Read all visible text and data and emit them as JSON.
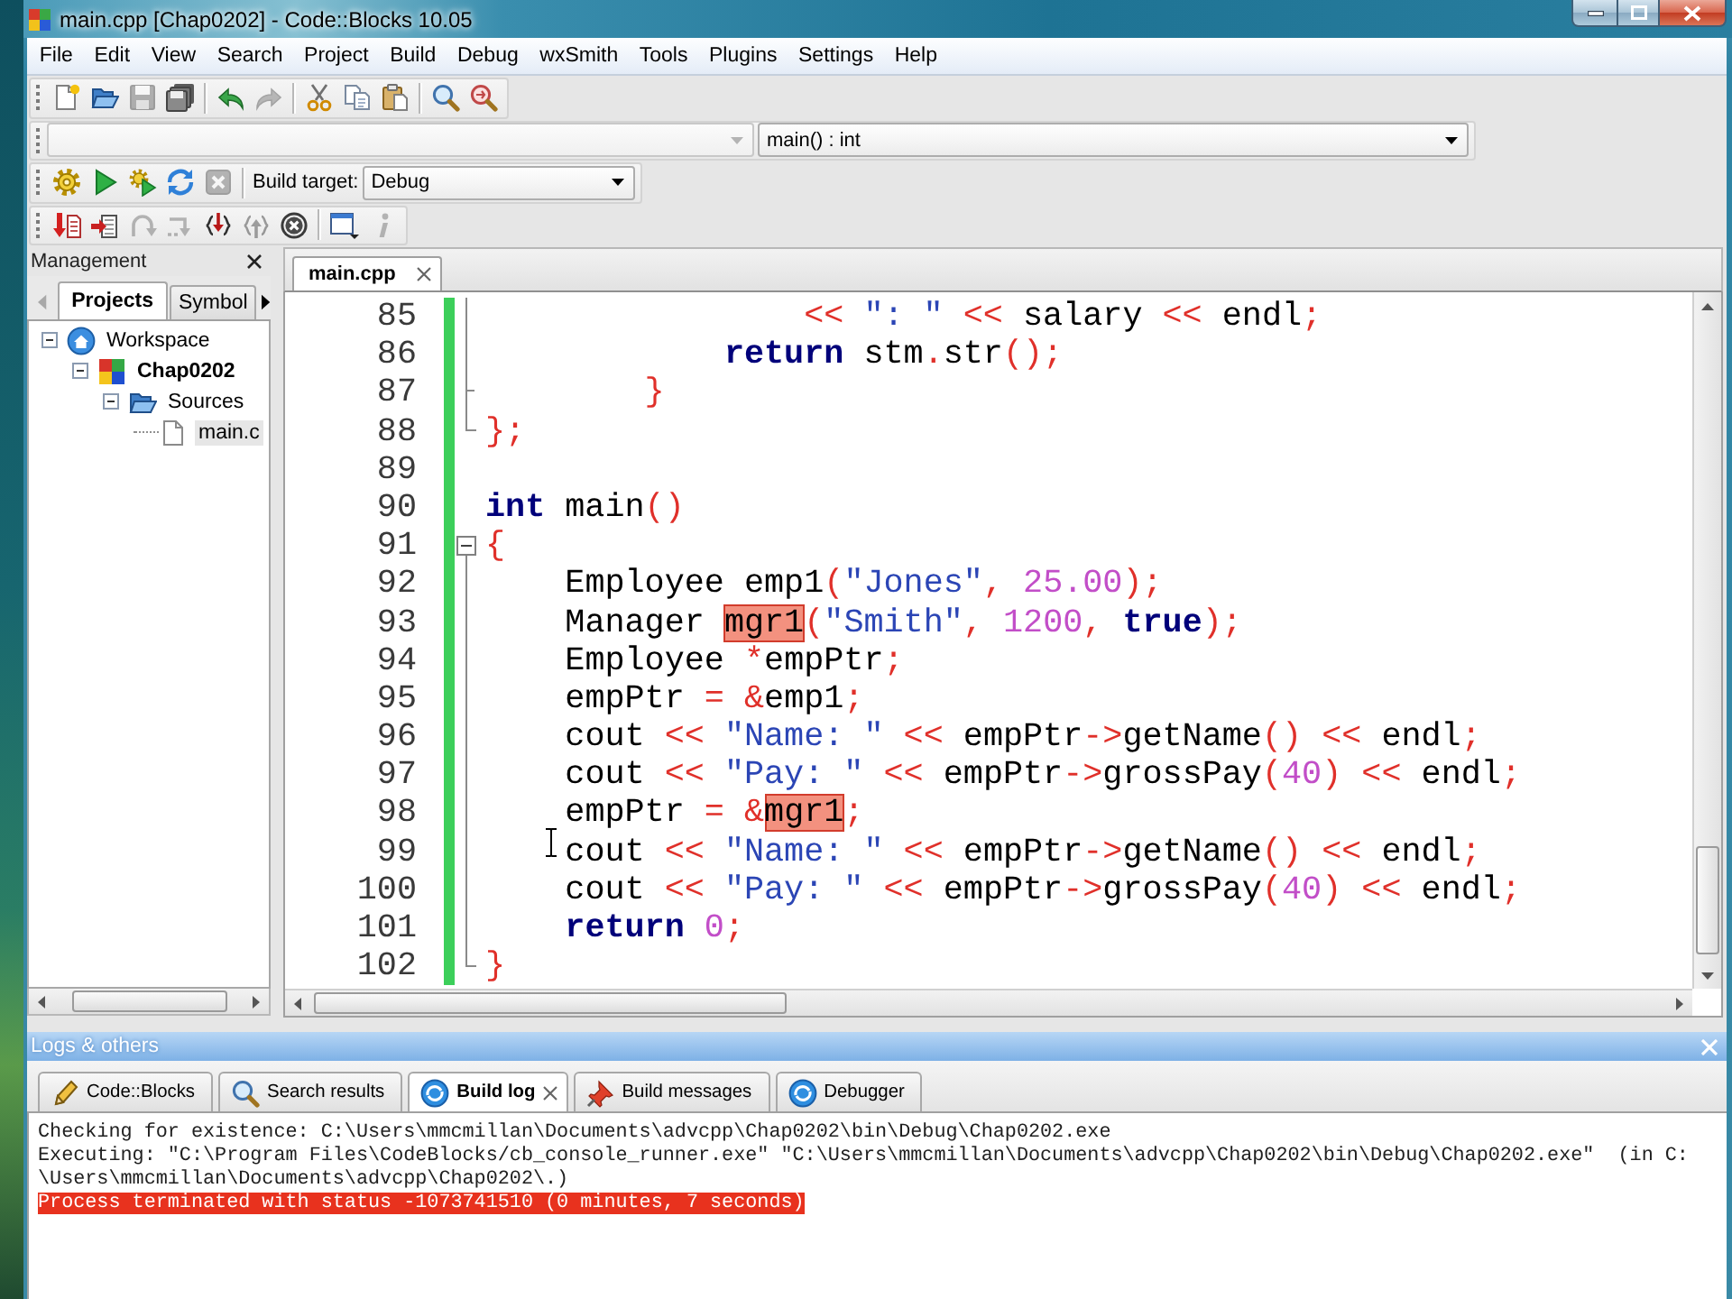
{
  "window": {
    "title": "main.cpp [Chap0202] - Code::Blocks 10.05"
  },
  "menu": [
    "File",
    "Edit",
    "View",
    "Search",
    "Project",
    "Build",
    "Debug",
    "wxSmith",
    "Tools",
    "Plugins",
    "Settings",
    "Help"
  ],
  "main_toolbar": {
    "groups": [
      [
        {
          "kind": "new",
          "disabled": false
        },
        {
          "kind": "open",
          "disabled": false
        },
        {
          "kind": "save",
          "disabled": true
        },
        {
          "kind": "saveall",
          "disabled": false
        }
      ],
      [
        {
          "kind": "undo",
          "disabled": false
        },
        {
          "kind": "redo",
          "disabled": true
        }
      ],
      [
        {
          "kind": "cut",
          "disabled": false
        },
        {
          "kind": "copy",
          "disabled": false
        },
        {
          "kind": "paste",
          "disabled": false
        }
      ],
      [
        {
          "kind": "find",
          "disabled": false
        },
        {
          "kind": "replace",
          "disabled": false
        }
      ]
    ]
  },
  "code_completion_toolbar": {
    "scope_box": {
      "disabled": true
    },
    "function_box": {
      "value": "main() : int",
      "disabled": false
    }
  },
  "compiler_toolbar": {
    "groups": [
      [
        {
          "kind": "build",
          "disabled": false
        },
        {
          "kind": "run",
          "disabled": false
        },
        {
          "kind": "buildrun",
          "disabled": false
        },
        {
          "kind": "rebuild",
          "disabled": false
        },
        {
          "kind": "abort",
          "disabled": true
        }
      ]
    ],
    "build_target_label": "Build target:",
    "build_target": "Debug"
  },
  "debugger_toolbar": {
    "groups": [
      [
        {
          "kind": "debug",
          "disabled": false
        },
        {
          "kind": "runtocursor",
          "disabled": false
        },
        {
          "kind": "nextline",
          "disabled": true
        },
        {
          "kind": "nextinstruction",
          "disabled": true
        },
        {
          "kind": "stepinto",
          "disabled": false
        },
        {
          "kind": "stepout",
          "disabled": true
        },
        {
          "kind": "stop",
          "disabled": false
        }
      ],
      [
        {
          "kind": "windows",
          "disabled": false
        },
        {
          "kind": "info",
          "disabled": true
        }
      ]
    ]
  },
  "management": {
    "title": "Management",
    "tabs": [
      {
        "label": "Projects",
        "selected": true
      },
      {
        "label": "Symbol",
        "selected": false
      }
    ],
    "tree": [
      {
        "label": "Workspace",
        "kind": "workspace",
        "expanded": true,
        "active": false,
        "selected": false,
        "children": [
          {
            "label": "Chap0202",
            "kind": "project",
            "expanded": true,
            "active": true,
            "selected": false,
            "children": [
              {
                "label": "Sources",
                "kind": "folder",
                "expanded": true,
                "active": false,
                "selected": false,
                "children": [
                  {
                    "label": "main.c",
                    "kind": "file",
                    "active": false,
                    "selected": true
                  }
                ]
              }
            ]
          }
        ]
      }
    ]
  },
  "editor": {
    "tabs": [
      {
        "label": "main.cpp",
        "selected": true
      }
    ],
    "lines": [
      {
        "number": "85",
        "changed": true,
        "fold": {
          "kind": "body"
        },
        "tokens": [
          {
            "kind": "op",
            "text": "                << "
          },
          {
            "kind": "string",
            "text": "\": \""
          },
          {
            "kind": "op",
            "text": " << "
          },
          {
            "kind": "plain",
            "text": "salary"
          },
          {
            "kind": "op",
            "text": " << "
          },
          {
            "kind": "plain",
            "text": "endl"
          },
          {
            "kind": "op",
            "text": ";"
          }
        ]
      },
      {
        "number": "86",
        "changed": true,
        "fold": {
          "kind": "body"
        },
        "tokens": [
          {
            "kind": "kw",
            "text": "            return"
          },
          {
            "kind": "plain",
            "text": " stm"
          },
          {
            "kind": "op",
            "text": "."
          },
          {
            "kind": "plain",
            "text": "str"
          },
          {
            "kind": "op",
            "text": "();"
          }
        ]
      },
      {
        "number": "87",
        "changed": true,
        "fold": {
          "kind": "inner_end"
        },
        "tokens": [
          {
            "kind": "op",
            "text": "        }"
          }
        ]
      },
      {
        "number": "88",
        "changed": true,
        "fold": {
          "kind": "end"
        },
        "tokens": [
          {
            "kind": "op",
            "text": "};"
          }
        ]
      },
      {
        "number": "89",
        "changed": true
      },
      {
        "number": "90",
        "changed": true,
        "tokens": [
          {
            "kind": "kw",
            "text": "int"
          },
          {
            "kind": "plain",
            "text": " main"
          },
          {
            "kind": "op",
            "text": "()"
          }
        ]
      },
      {
        "number": "91",
        "changed": true,
        "fold": {
          "kind": "start"
        },
        "tokens": [
          {
            "kind": "op",
            "text": "{"
          }
        ]
      },
      {
        "number": "92",
        "changed": true,
        "fold": {
          "kind": "body"
        },
        "tokens": [
          {
            "kind": "plain",
            "text": "    Employee emp1"
          },
          {
            "kind": "op",
            "text": "("
          },
          {
            "kind": "string",
            "text": "\"Jones\""
          },
          {
            "kind": "op",
            "text": ", "
          },
          {
            "kind": "number",
            "text": "25.00"
          },
          {
            "kind": "op",
            "text": ");"
          }
        ]
      },
      {
        "number": "93",
        "changed": true,
        "fold": {
          "kind": "body"
        },
        "tokens": [
          {
            "kind": "plain",
            "text": "    Manager "
          },
          {
            "kind": "match",
            "text": "mgr1"
          },
          {
            "kind": "op",
            "text": "("
          },
          {
            "kind": "string",
            "text": "\"Smith\""
          },
          {
            "kind": "op",
            "text": ", "
          },
          {
            "kind": "number",
            "text": "1200"
          },
          {
            "kind": "op",
            "text": ", "
          },
          {
            "kind": "kw",
            "text": "true"
          },
          {
            "kind": "op",
            "text": ");"
          }
        ]
      },
      {
        "number": "94",
        "changed": true,
        "fold": {
          "kind": "body"
        },
        "tokens": [
          {
            "kind": "plain",
            "text": "    Employee "
          },
          {
            "kind": "op",
            "text": "*"
          },
          {
            "kind": "plain",
            "text": "empPtr"
          },
          {
            "kind": "op",
            "text": ";"
          }
        ]
      },
      {
        "number": "95",
        "changed": true,
        "fold": {
          "kind": "body"
        },
        "tokens": [
          {
            "kind": "plain",
            "text": "    empPtr "
          },
          {
            "kind": "op",
            "text": "= &"
          },
          {
            "kind": "plain",
            "text": "emp1"
          },
          {
            "kind": "op",
            "text": ";"
          }
        ]
      },
      {
        "number": "96",
        "changed": true,
        "fold": {
          "kind": "body"
        },
        "tokens": [
          {
            "kind": "plain",
            "text": "    cout "
          },
          {
            "kind": "op",
            "text": "<< "
          },
          {
            "kind": "string",
            "text": "\"Name: \""
          },
          {
            "kind": "op",
            "text": " << "
          },
          {
            "kind": "plain",
            "text": "empPtr"
          },
          {
            "kind": "op",
            "text": "->"
          },
          {
            "kind": "plain",
            "text": "getName"
          },
          {
            "kind": "op",
            "text": "() << "
          },
          {
            "kind": "plain",
            "text": "endl"
          },
          {
            "kind": "op",
            "text": ";"
          }
        ]
      },
      {
        "number": "97",
        "changed": true,
        "fold": {
          "kind": "body"
        },
        "tokens": [
          {
            "kind": "plain",
            "text": "    cout "
          },
          {
            "kind": "op",
            "text": "<< "
          },
          {
            "kind": "string",
            "text": "\"Pay: \""
          },
          {
            "kind": "op",
            "text": " << "
          },
          {
            "kind": "plain",
            "text": "empPtr"
          },
          {
            "kind": "op",
            "text": "->"
          },
          {
            "kind": "plain",
            "text": "grossPay"
          },
          {
            "kind": "op",
            "text": "("
          },
          {
            "kind": "number",
            "text": "40"
          },
          {
            "kind": "op",
            "text": ") << "
          },
          {
            "kind": "plain",
            "text": "endl"
          },
          {
            "kind": "op",
            "text": ";"
          }
        ]
      },
      {
        "number": "98",
        "changed": true,
        "fold": {
          "kind": "body"
        },
        "tokens": [
          {
            "kind": "plain",
            "text": "    empPtr "
          },
          {
            "kind": "op",
            "text": "= &"
          },
          {
            "kind": "match",
            "text": "mgr1"
          },
          {
            "kind": "op",
            "text": ";"
          }
        ]
      },
      {
        "number": "99",
        "changed": true,
        "fold": {
          "kind": "body"
        },
        "tokens": [
          {
            "kind": "plain",
            "text": "    cout "
          },
          {
            "kind": "op",
            "text": "<< "
          },
          {
            "kind": "string",
            "text": "\"Name: \""
          },
          {
            "kind": "op",
            "text": " << "
          },
          {
            "kind": "plain",
            "text": "empPtr"
          },
          {
            "kind": "op",
            "text": "->"
          },
          {
            "kind": "plain",
            "text": "getName"
          },
          {
            "kind": "op",
            "text": "() << "
          },
          {
            "kind": "plain",
            "text": "endl"
          },
          {
            "kind": "op",
            "text": ";"
          }
        ]
      },
      {
        "number": "100",
        "changed": true,
        "fold": {
          "kind": "body"
        },
        "tokens": [
          {
            "kind": "plain",
            "text": "    cout "
          },
          {
            "kind": "op",
            "text": "<< "
          },
          {
            "kind": "string",
            "text": "\"Pay: \""
          },
          {
            "kind": "op",
            "text": " << "
          },
          {
            "kind": "plain",
            "text": "empPtr"
          },
          {
            "kind": "op",
            "text": "->"
          },
          {
            "kind": "plain",
            "text": "grossPay"
          },
          {
            "kind": "op",
            "text": "("
          },
          {
            "kind": "number",
            "text": "40"
          },
          {
            "kind": "op",
            "text": ") << "
          },
          {
            "kind": "plain",
            "text": "endl"
          },
          {
            "kind": "op",
            "text": ";"
          }
        ]
      },
      {
        "number": "101",
        "changed": true,
        "fold": {
          "kind": "body"
        },
        "tokens": [
          {
            "kind": "kw",
            "text": "    return"
          },
          {
            "kind": "number",
            "text": " 0"
          },
          {
            "kind": "op",
            "text": ";"
          }
        ]
      },
      {
        "number": "102",
        "changed": true,
        "fold": {
          "kind": "end"
        },
        "tokens": [
          {
            "kind": "op",
            "text": "}"
          }
        ]
      }
    ]
  },
  "logs": {
    "title": "Logs & others",
    "tabs": [
      {
        "label": "Code::Blocks",
        "kind": "pencil",
        "selected": false
      },
      {
        "label": "Search results",
        "kind": "search",
        "selected": false
      },
      {
        "label": "Build log",
        "kind": "log",
        "selected": true
      },
      {
        "label": "Build messages",
        "kind": "pin",
        "selected": false
      },
      {
        "label": "Debugger",
        "kind": "debug",
        "selected": false
      }
    ],
    "lines": [
      {
        "kind": "info",
        "text": "Checking for existence: C:\\Users\\mmcmillan\\Documents\\advcpp\\Chap0202\\bin\\Debug\\Chap0202.exe"
      },
      {
        "kind": "info",
        "text": "Executing: \"C:\\Program Files\\CodeBlocks/cb_console_runner.exe\" \"C:\\Users\\mmcmillan\\Documents\\advcpp\\Chap0202\\bin\\Debug\\Chap0202.exe\"  (in C:"
      },
      {
        "kind": "info",
        "text": "\\Users\\mmcmillan\\Documents\\advcpp\\Chap0202\\.)"
      },
      {
        "kind": "error",
        "text": "Process terminated with status -1073741510 (0 minutes, 7 seconds)"
      }
    ]
  }
}
